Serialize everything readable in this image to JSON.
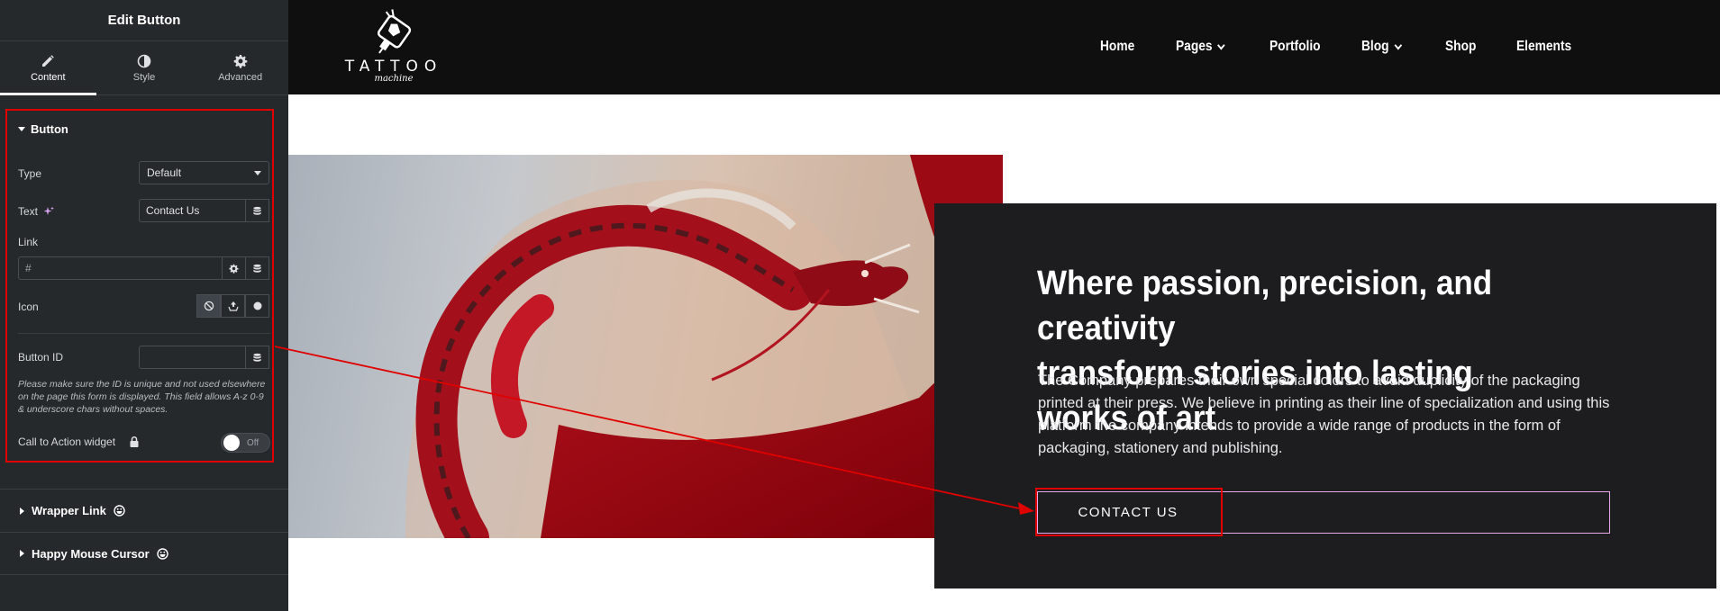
{
  "panel": {
    "title": "Edit Button",
    "tabs": [
      {
        "label": "Content",
        "icon": "pencil-icon",
        "active": true
      },
      {
        "label": "Style",
        "icon": "contrast-icon",
        "active": false
      },
      {
        "label": "Advanced",
        "icon": "gear-icon",
        "active": false
      }
    ],
    "section": {
      "title": "Button",
      "type_label": "Type",
      "type_value": "Default",
      "text_label": "Text",
      "text_value": "Contact Us",
      "link_label": "Link",
      "link_value": "#",
      "icon_label": "Icon",
      "button_id_label": "Button ID",
      "button_id_value": "",
      "hint": "Please make sure the ID is unique and not used elsewhere on the page this form is displayed. This field allows A-z  0-9 & underscore chars without spaces.",
      "cta_label": "Call to Action widget",
      "toggle_state": "Off"
    },
    "collapsed_sections": [
      "Wrapper Link",
      "Happy Mouse Cursor"
    ]
  },
  "site": {
    "logo_word": "TATTOO",
    "logo_sub": "machine",
    "nav": [
      "Home",
      "Pages",
      "Portfolio",
      "Blog",
      "Shop",
      "Elements"
    ],
    "headline_line1": "Where passion, precision, and creativity",
    "headline_line2": "transform stories into lasting works of art",
    "body": "The Company prepares their own special colors to avoid duplicity of the packaging printed at their press. We believe in printing as their line of specialization and using this platform the company intends to provide a wide range of products in the form of packaging, stationery and publishing.",
    "button_label": "CONTACT US"
  },
  "colors": {
    "panel_bg": "#26292c",
    "highlight": "#e00000",
    "header_bg": "#0f0f10",
    "card_bg": "#1d1d20",
    "button_border": "#e8a9e8"
  }
}
